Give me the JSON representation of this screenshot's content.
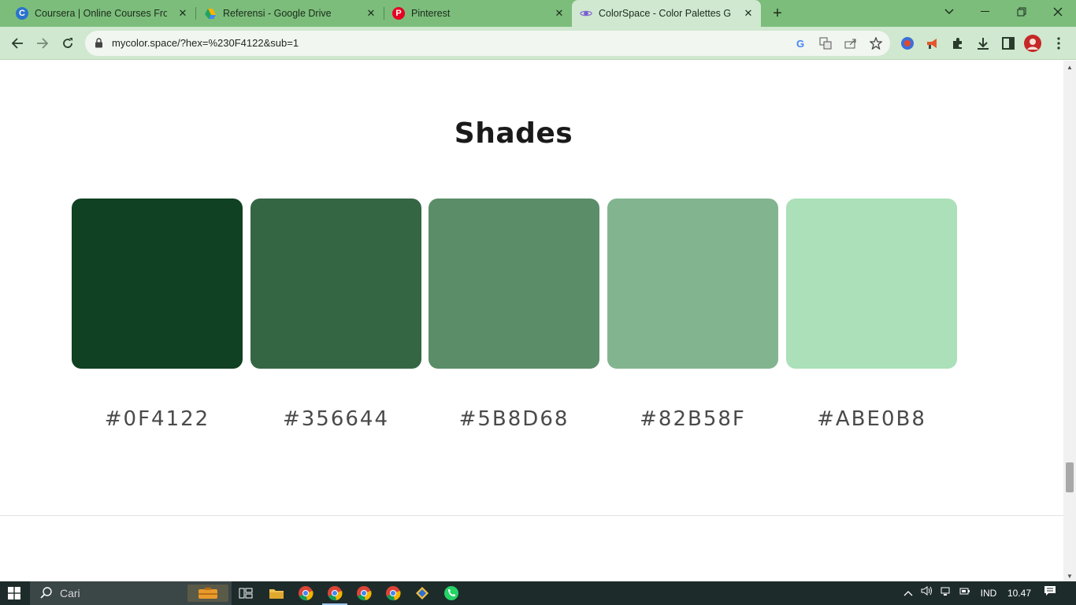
{
  "browser": {
    "tabs": [
      {
        "title": "Coursera | Online Courses From",
        "icon": "coursera-icon",
        "active": false
      },
      {
        "title": "Referensi - Google Drive",
        "icon": "google-drive-icon",
        "active": false
      },
      {
        "title": "Pinterest",
        "icon": "pinterest-icon",
        "active": false
      },
      {
        "title": "ColorSpace - Color Palettes Gen",
        "icon": "colorspace-icon",
        "active": true
      }
    ],
    "url": "mycolor.space/?hex=%230F4122&sub=1"
  },
  "page": {
    "heading": "Shades",
    "shades": [
      {
        "hex": "#0F4122",
        "color": "#0F4122"
      },
      {
        "hex": "#356644",
        "color": "#356644"
      },
      {
        "hex": "#5B8D68",
        "color": "#5B8D68"
      },
      {
        "hex": "#82B58F",
        "color": "#82B58F"
      },
      {
        "hex": "#ABE0B8",
        "color": "#ABE0B8"
      }
    ]
  },
  "taskbar": {
    "search_placeholder": "Cari",
    "language": "IND",
    "time": "10.47"
  },
  "colors": {
    "tabstrip": "#7cbd7b",
    "toolbar": "#cfe8cf",
    "taskbar": "#1e2b2b"
  }
}
